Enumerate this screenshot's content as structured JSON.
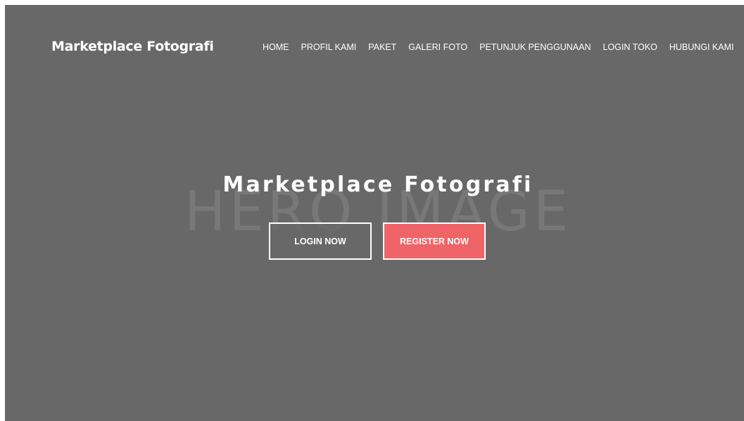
{
  "site": {
    "brand": "Marketplace Fotografi"
  },
  "nav": {
    "items": [
      {
        "label": "HOME"
      },
      {
        "label": "PROFIL KAMI"
      },
      {
        "label": "PAKET"
      },
      {
        "label": "GALERI FOTO"
      },
      {
        "label": "PETUNJUK PENGGUNAAN"
      },
      {
        "label": "LOGIN TOKO"
      },
      {
        "label": "HUBUNGI KAMI"
      }
    ]
  },
  "hero": {
    "watermark": "HERO IMAGE",
    "title": "Marketplace Fotografi",
    "login_label": "LOGIN NOW",
    "register_label": "REGISTER NOW"
  },
  "colors": {
    "background": "#686868",
    "register_button": "#ee6467",
    "text": "#ffffff"
  }
}
